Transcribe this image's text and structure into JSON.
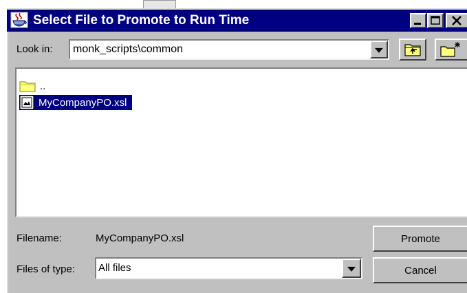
{
  "window": {
    "title": "Select File to Promote to Run Time"
  },
  "look_in": {
    "label": "Look in:",
    "value": "monk_scripts\\common"
  },
  "file_list": {
    "items": [
      {
        "label": "..",
        "type": "folder",
        "selected": false
      },
      {
        "label": "MyCompanyPO.xsl",
        "type": "file",
        "selected": true
      }
    ]
  },
  "filename": {
    "label": "Filename:",
    "value": "MyCompanyPO.xsl"
  },
  "files_of_type": {
    "label": "Files of type:",
    "value": "All files"
  },
  "buttons": {
    "promote": "Promote",
    "cancel": "Cancel"
  },
  "icons": {
    "title": "java-cup-icon",
    "up_folder": "up-folder-icon",
    "new_folder": "new-folder-icon",
    "folder": "folder-icon",
    "file": "xsl-file-icon"
  },
  "colors": {
    "titlebar": "#000080",
    "face": "#c0c0c0",
    "selection": "#000080"
  }
}
